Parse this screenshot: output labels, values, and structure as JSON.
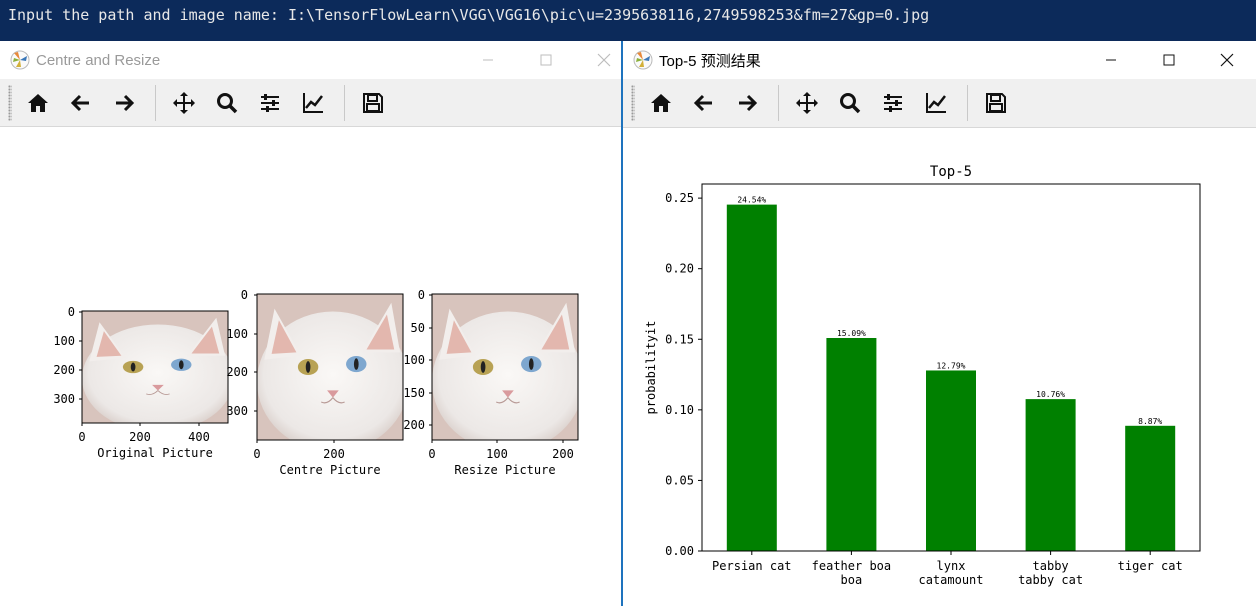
{
  "console": {
    "text": "Input the path and image name: I:\\TensorFlowLearn\\VGG\\VGG16\\pic\\u=2395638116,2749598253&fm=27&gp=0.jpg"
  },
  "left_window": {
    "title": "Centre and Resize",
    "panels": [
      {
        "caption": "Original Picture",
        "yticks": [
          "0",
          "100",
          "200",
          "300"
        ],
        "xticks": [
          "0",
          "200",
          "400"
        ]
      },
      {
        "caption": "Centre Picture",
        "yticks": [
          "0",
          "100",
          "200",
          "300"
        ],
        "xticks": [
          "0",
          "200"
        ]
      },
      {
        "caption": "Resize Picture",
        "yticks": [
          "0",
          "50",
          "100",
          "150",
          "200"
        ],
        "xticks": [
          "0",
          "100",
          "200"
        ]
      }
    ]
  },
  "right_window": {
    "title": "Top-5 预测结果"
  },
  "toolbar_icons": [
    "home-icon",
    "back-arrow-icon",
    "forward-arrow-icon",
    "pan-icon",
    "zoom-icon",
    "configure-subplots-icon",
    "edit-axes-icon",
    "save-icon"
  ],
  "colors": {
    "bar": "#008000",
    "console_bg": "#0c2a5a"
  },
  "chart_data": {
    "type": "bar",
    "title": "Top-5",
    "xlabel": "",
    "ylabel": "probabilityit",
    "ylim": [
      0,
      0.26
    ],
    "yticks": [
      0.0,
      0.05,
      0.1,
      0.15,
      0.2,
      0.25
    ],
    "ytick_labels": [
      "0.00",
      "0.05",
      "0.10",
      "0.15",
      "0.20",
      "0.25"
    ],
    "categories": [
      [
        "Persian cat"
      ],
      [
        "feather boa",
        "boa"
      ],
      [
        "lynx",
        "catamount"
      ],
      [
        "tabby",
        "tabby cat"
      ],
      [
        "tiger cat"
      ]
    ],
    "values": [
      0.2454,
      0.1509,
      0.1279,
      0.1076,
      0.0887
    ],
    "data_labels": [
      "24.54%",
      "15.09%",
      "12.79%",
      "10.76%",
      "8.87%"
    ],
    "grid": false
  }
}
